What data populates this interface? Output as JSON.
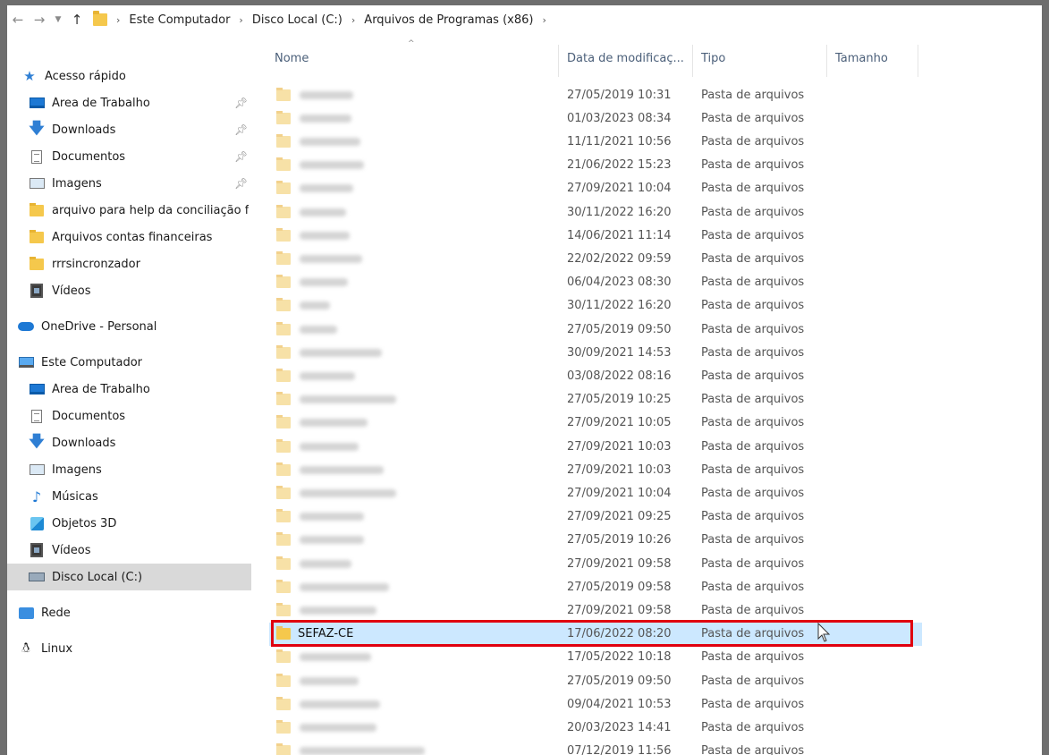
{
  "breadcrumb": [
    "Este Computador",
    "Disco Local (C:)",
    "Arquivos de Programas (x86)"
  ],
  "columns": {
    "name": "Nome",
    "date": "Data de modificaç...",
    "type": "Tipo",
    "size": "Tamanho"
  },
  "sidebar": {
    "quick_access": "Acesso rápido",
    "quick_items": [
      {
        "label": "Área de Trabalho",
        "icon": "desktop-icon"
      },
      {
        "label": "Downloads",
        "icon": "download-icon"
      },
      {
        "label": "Documentos",
        "icon": "documents-icon"
      },
      {
        "label": "Imagens",
        "icon": "pictures-icon"
      },
      {
        "label": "arquivo para help da conciliação f",
        "icon": "folder-icon"
      },
      {
        "label": "Arquivos contas financeiras",
        "icon": "folder-icon"
      },
      {
        "label": "rrrsincronzador",
        "icon": "folder-icon"
      },
      {
        "label": "Vídeos",
        "icon": "videos-icon"
      }
    ],
    "onedrive": "OneDrive - Personal",
    "this_pc": "Este Computador",
    "pc_items": [
      {
        "label": "Área de Trabalho",
        "icon": "desktop-icon"
      },
      {
        "label": "Documentos",
        "icon": "documents-icon"
      },
      {
        "label": "Downloads",
        "icon": "download-icon"
      },
      {
        "label": "Imagens",
        "icon": "pictures-icon"
      },
      {
        "label": "Músicas",
        "icon": "music-icon"
      },
      {
        "label": "Objetos 3D",
        "icon": "3d-objects-icon"
      },
      {
        "label": "Vídeos",
        "icon": "videos-icon"
      },
      {
        "label": "Disco Local (C:)",
        "icon": "local-disk-icon"
      }
    ],
    "network": "Rede",
    "linux": "Linux"
  },
  "files": [
    {
      "name": "",
      "date": "27/05/2019 10:31",
      "type": "Pasta de arquivos"
    },
    {
      "name": "",
      "date": "01/03/2023 08:34",
      "type": "Pasta de arquivos"
    },
    {
      "name": "",
      "date": "11/11/2021 10:56",
      "type": "Pasta de arquivos"
    },
    {
      "name": "",
      "date": "21/06/2022 15:23",
      "type": "Pasta de arquivos"
    },
    {
      "name": "",
      "date": "27/09/2021 10:04",
      "type": "Pasta de arquivos"
    },
    {
      "name": "",
      "date": "30/11/2022 16:20",
      "type": "Pasta de arquivos"
    },
    {
      "name": "",
      "date": "14/06/2021 11:14",
      "type": "Pasta de arquivos"
    },
    {
      "name": "",
      "date": "22/02/2022 09:59",
      "type": "Pasta de arquivos"
    },
    {
      "name": "",
      "date": "06/04/2023 08:30",
      "type": "Pasta de arquivos"
    },
    {
      "name": "",
      "date": "30/11/2022 16:20",
      "type": "Pasta de arquivos"
    },
    {
      "name": "",
      "date": "27/05/2019 09:50",
      "type": "Pasta de arquivos"
    },
    {
      "name": "",
      "date": "30/09/2021 14:53",
      "type": "Pasta de arquivos"
    },
    {
      "name": "",
      "date": "03/08/2022 08:16",
      "type": "Pasta de arquivos"
    },
    {
      "name": "",
      "date": "27/05/2019 10:25",
      "type": "Pasta de arquivos"
    },
    {
      "name": "",
      "date": "27/09/2021 10:05",
      "type": "Pasta de arquivos"
    },
    {
      "name": "",
      "date": "27/09/2021 10:03",
      "type": "Pasta de arquivos"
    },
    {
      "name": "",
      "date": "27/09/2021 10:03",
      "type": "Pasta de arquivos"
    },
    {
      "name": "",
      "date": "27/09/2021 10:04",
      "type": "Pasta de arquivos"
    },
    {
      "name": "",
      "date": "27/09/2021 09:25",
      "type": "Pasta de arquivos"
    },
    {
      "name": "",
      "date": "27/05/2019 10:26",
      "type": "Pasta de arquivos"
    },
    {
      "name": "",
      "date": "27/09/2021 09:58",
      "type": "Pasta de arquivos"
    },
    {
      "name": "",
      "date": "27/05/2019 09:58",
      "type": "Pasta de arquivos"
    },
    {
      "name": "",
      "date": "27/09/2021 09:58",
      "type": "Pasta de arquivos"
    },
    {
      "name": "SEFAZ-CE",
      "date": "17/06/2022 08:20",
      "type": "Pasta de arquivos",
      "highlighted": true
    },
    {
      "name": "",
      "date": "17/05/2022 10:18",
      "type": "Pasta de arquivos"
    },
    {
      "name": "",
      "date": "27/05/2019 09:50",
      "type": "Pasta de arquivos"
    },
    {
      "name": "",
      "date": "09/04/2021 10:53",
      "type": "Pasta de arquivos"
    },
    {
      "name": "",
      "date": "20/03/2023 14:41",
      "type": "Pasta de arquivos"
    },
    {
      "name": "",
      "date": "07/12/2019 11:56",
      "type": "Pasta de arquivos"
    }
  ],
  "colors": {
    "highlight": "#cce8ff",
    "annotation_box": "#e0000f",
    "folder": "#f5c84c"
  }
}
